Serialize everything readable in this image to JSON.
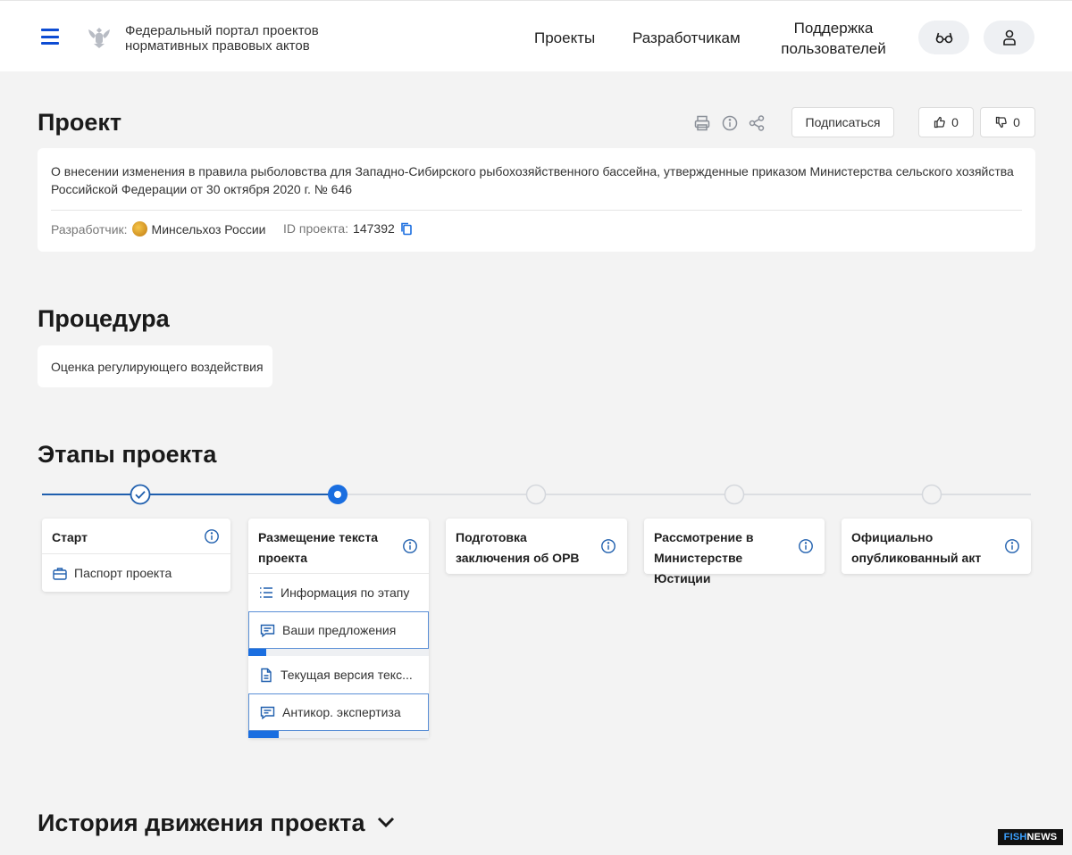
{
  "header": {
    "portal_name": "Федеральный портал проектов нормативных правовых актов",
    "nav": {
      "projects": "Проекты",
      "developers": "Разработчикам",
      "support": "Поддержка пользователей"
    }
  },
  "project": {
    "title": "Проект",
    "subscribe_label": "Подписаться",
    "likes": "0",
    "dislikes": "0",
    "description": "О внесении изменения в правила рыболовства для Западно-Сибирского рыбохозяйственного бассейна, утвержденные приказом Министерства сельского хозяйства Российской Федерации от 30 октября 2020 г. № 646",
    "developer_label": "Разработчик:",
    "developer_name": "Минсельхоз России",
    "id_label": "ID проекта:",
    "id_value": "147392"
  },
  "procedure": {
    "title": "Процедура",
    "value": "Оценка регулирующего воздействия"
  },
  "stages": {
    "title": "Этапы проекта",
    "items": [
      {
        "label": "Старт",
        "status": "done",
        "sub": [
          {
            "label": "Паспорт проекта",
            "icon": "briefcase-icon"
          }
        ]
      },
      {
        "label": "Размещение текста проекта",
        "status": "current",
        "sub": [
          {
            "label": "Информация по этапу",
            "icon": "list-icon"
          },
          {
            "label": "Ваши предложения",
            "icon": "comment-icon",
            "progress": 0.1
          },
          {
            "label": "Текущая версия текс...",
            "icon": "document-icon"
          },
          {
            "label": "Антикор. экспертиза",
            "icon": "comment-icon",
            "progress": 0.17
          }
        ]
      },
      {
        "label": "Подготовка заключения об ОРВ",
        "status": "pending"
      },
      {
        "label": "Рассмотрение в Министерстве Юстиции",
        "status": "pending"
      },
      {
        "label": "Официально опубликованный акт",
        "status": "pending"
      }
    ]
  },
  "history": {
    "title": "История движения проекта"
  },
  "watermark": {
    "part1": "FISH",
    "part2": "NEWS"
  },
  "colors": {
    "accent": "#0d4cd3",
    "progress": "#1a6ee0",
    "background": "#f3f3f3"
  }
}
